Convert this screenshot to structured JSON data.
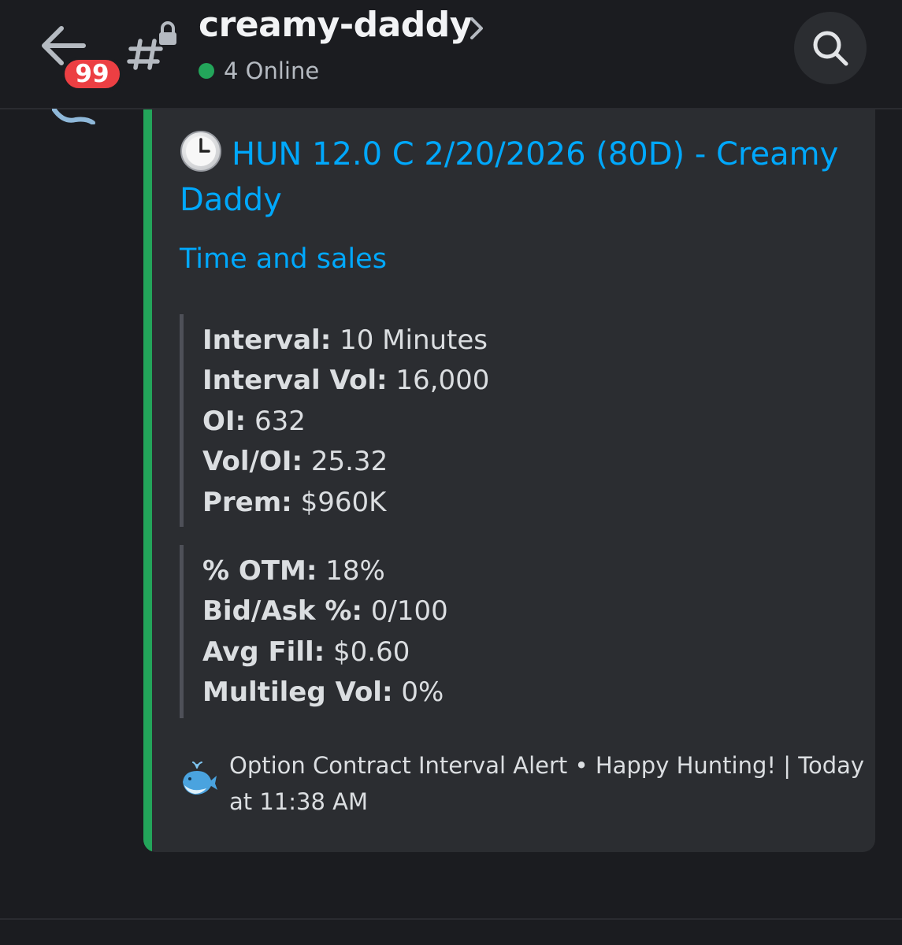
{
  "header": {
    "badge_count": "99",
    "channel_name": "creamy-daddy",
    "online_text": "4 Online"
  },
  "embed": {
    "title": "HUN 12.0 C 2/20/2026 (80D) - Creamy Daddy",
    "link_label": "Time and sales",
    "group1": [
      {
        "label": "Interval:",
        "value": "10 Minutes"
      },
      {
        "label": "Interval Vol:",
        "value": "16,000"
      },
      {
        "label": "OI:",
        "value": "632"
      },
      {
        "label": "Vol/OI:",
        "value": "25.32"
      },
      {
        "label": "Prem:",
        "value": "$960K"
      }
    ],
    "group2": [
      {
        "label": "% OTM:",
        "value": "18%"
      },
      {
        "label": "Bid/Ask %:",
        "value": "0/100"
      },
      {
        "label": "Avg Fill:",
        "value": "$0.60"
      },
      {
        "label": "Multileg Vol:",
        "value": "0%"
      }
    ],
    "footer_text": "Option Contract Interval Alert  •  Happy Hunting! | Today at 11:38 AM"
  },
  "colors": {
    "accent_bar": "#23a55a",
    "link": "#00a8fc",
    "badge": "#ec3f43",
    "online": "#23a55a"
  },
  "icons": [
    "back-arrow-icon",
    "hash-lock-icon",
    "chevron-right-icon",
    "search-icon",
    "clock-icon",
    "whale-icon"
  ]
}
